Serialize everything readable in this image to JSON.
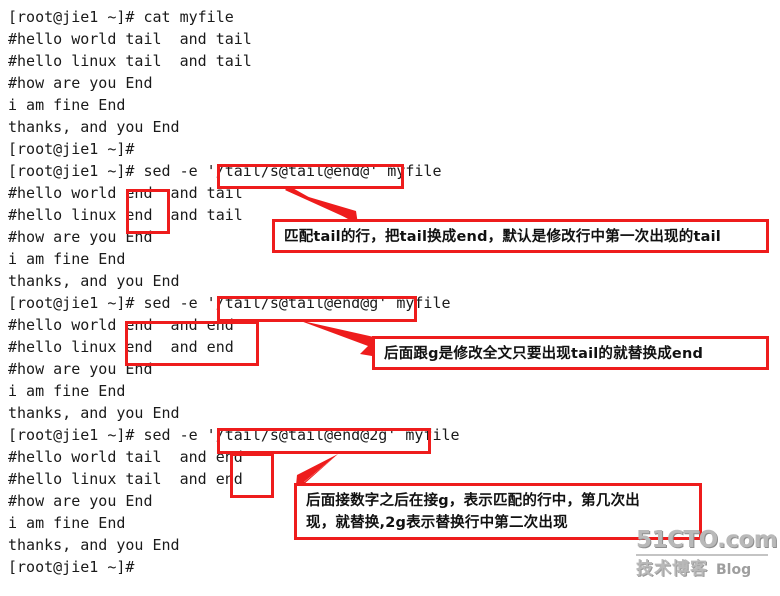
{
  "terminal": {
    "lines": [
      "[root@jie1 ~]# cat myfile",
      "#hello world tail  and tail",
      "#hello linux tail  and tail",
      "#how are you End",
      "i am fine End",
      "thanks, and you End",
      "[root@jie1 ~]#",
      "[root@jie1 ~]# sed -e '/tail/s@tail@end@' myfile",
      "#hello world end  and tail",
      "#hello linux end  and tail",
      "#how are you End",
      "i am fine End",
      "thanks, and you End",
      "[root@jie1 ~]# sed -e '/tail/s@tail@end@g' myfile",
      "#hello world end  and end",
      "#hello linux end  and end",
      "#how are you End",
      "i am fine End",
      "thanks, and you End",
      "[root@jie1 ~]# sed -e '/tail/s@tail@end@2g' myfile",
      "#hello world tail  and end",
      "#hello linux tail  and end",
      "#how are you End",
      "i am fine End",
      "thanks, and you End",
      "[root@jie1 ~]#"
    ]
  },
  "annotations": {
    "accent_color": "#ee1c1c",
    "command_highlights": [
      {
        "label": "'/tail/s@tail@end@'"
      },
      {
        "label": "'/tail/s@tail@end@g'"
      },
      {
        "label": "'/tail/s@tail@end@2g'"
      }
    ],
    "result_highlights": [
      {
        "label": "end"
      },
      {
        "label": "end  and end"
      },
      {
        "label": "end"
      }
    ],
    "notes": [
      {
        "lines": [
          "匹配tail的行，把tail换成end，默认是修改行中第一次出现的tail"
        ]
      },
      {
        "lines": [
          "后面跟g是修改全文只要出现tail的就替换成end"
        ]
      },
      {
        "lines": [
          "后面接数字之后在接g，表示匹配的行中，第几次出",
          "现，就替换,2g表示替换行中第二次出现"
        ]
      }
    ]
  },
  "watermark": {
    "site": "51CTO.com",
    "cn": "技术博客",
    "blog": "Blog"
  }
}
